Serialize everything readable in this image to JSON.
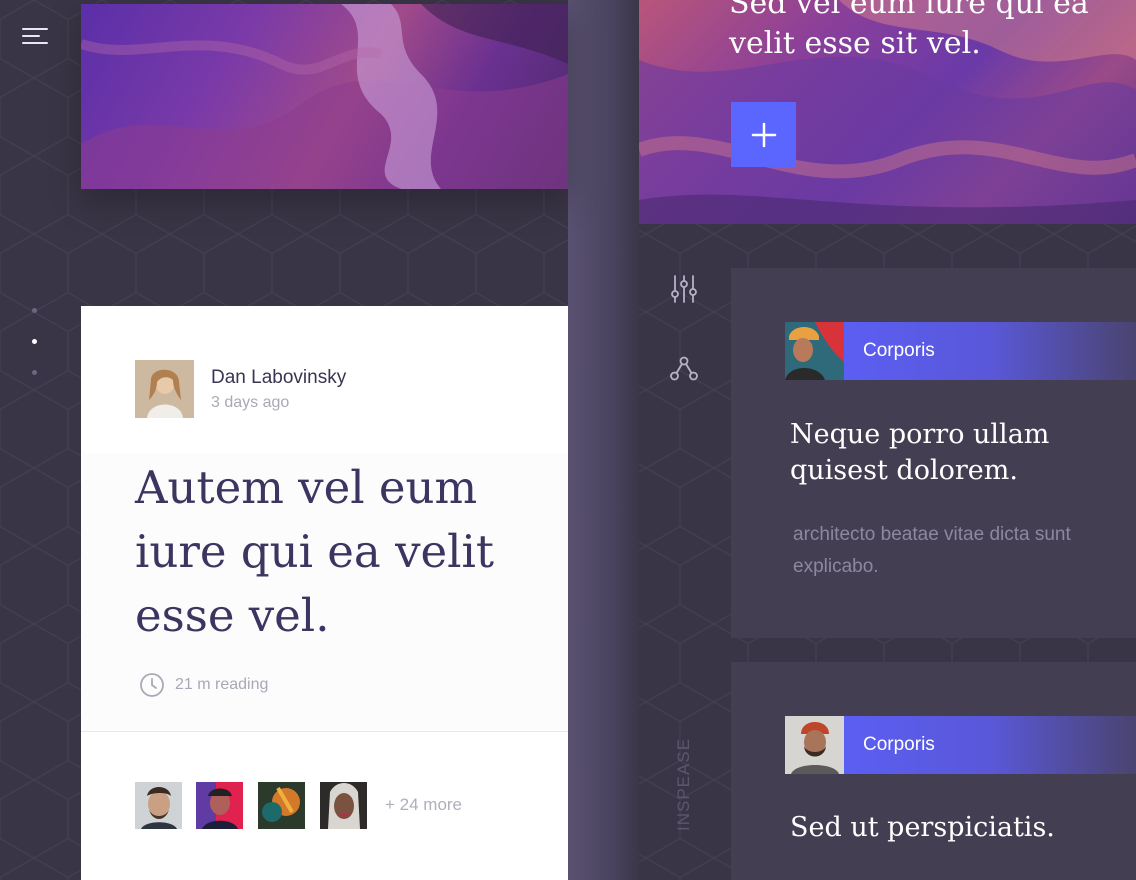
{
  "menu": {
    "icon": "menu-icon"
  },
  "pager": {
    "count": 3,
    "active_index": 1
  },
  "hero_right": {
    "text": "Sed vel eum iure qui ea velit esse sit vel.",
    "add_icon": "plus-icon"
  },
  "article": {
    "author": {
      "name": "Dan Labovinsky",
      "time": "3 days ago"
    },
    "headline": "Autem vel eum iure qui ea velit esse vel.",
    "read_time": "21 m reading",
    "read_time_icon": "clock-icon",
    "more_readers": "+ 24 more"
  },
  "sidebar": {
    "icons": [
      "sliders-icon",
      "share-icon"
    ],
    "brand": "INSPEASE"
  },
  "posts": [
    {
      "tag": "Corporis",
      "title": "Neque porro ullam quisest dolorem.",
      "excerpt": "architecto beatae vitae dicta sunt explicabo."
    },
    {
      "tag": "Corporis",
      "title": "Sed ut perspiciatis."
    }
  ],
  "colors": {
    "accent": "#5b66ff",
    "background": "#3a3546",
    "card_dark": "#433e52",
    "headline": "#3c3560"
  }
}
